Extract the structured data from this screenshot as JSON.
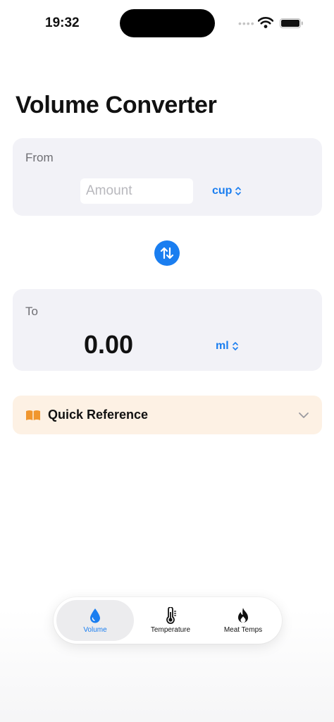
{
  "status_bar": {
    "time": "19:32",
    "signal_icon": "cellular-dots-icon",
    "wifi_icon": "wifi-icon",
    "battery_icon": "battery-icon"
  },
  "header": {
    "title": "Volume Converter"
  },
  "from_card": {
    "label": "From",
    "amount": {
      "value": "",
      "placeholder": "Amount"
    },
    "unit": "cup"
  },
  "swap": {
    "icon": "swap-arrows-icon"
  },
  "to_card": {
    "label": "To",
    "result": "0.00",
    "unit": "ml"
  },
  "quick_reference": {
    "label": "Quick Reference",
    "icon": "book-icon",
    "expanded": false
  },
  "tab_bar": {
    "tabs": [
      {
        "label": "Volume",
        "icon": "drop-icon",
        "active": true
      },
      {
        "label": "Temperature",
        "icon": "thermometer-icon",
        "active": false
      },
      {
        "label": "Meat Temps",
        "icon": "flame-icon",
        "active": false
      }
    ]
  },
  "colors": {
    "accent": "#1a7ef0",
    "card_background": "#f2f2f7",
    "quick_reference_background": "#fdf1e4",
    "book_icon": "#f0962e"
  }
}
